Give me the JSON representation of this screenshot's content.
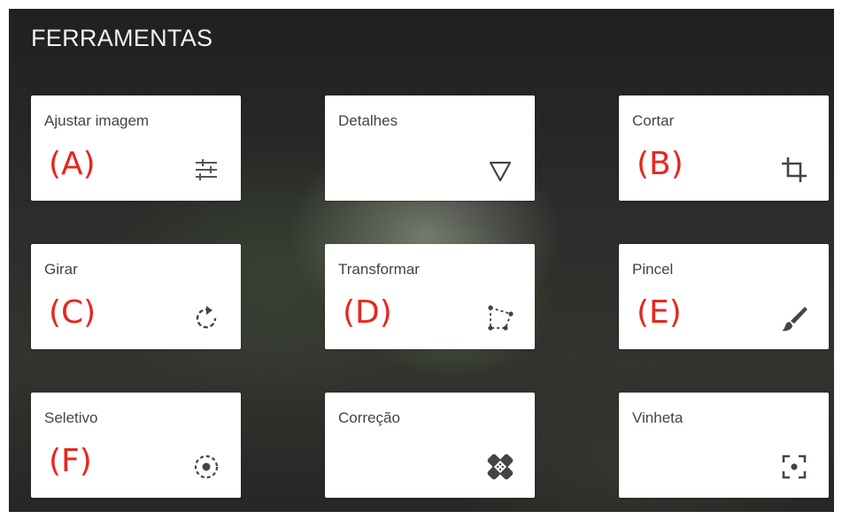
{
  "panel": {
    "title": "FERRAMENTAS"
  },
  "tools": [
    {
      "label": "Ajustar imagem",
      "marker": "(A)",
      "icon": "tune-sliders-icon"
    },
    {
      "label": "Detalhes",
      "marker": "",
      "icon": "triangle-down-icon"
    },
    {
      "label": "Cortar",
      "marker": "(B)",
      "icon": "crop-icon"
    },
    {
      "label": "Girar",
      "marker": "(C)",
      "icon": "rotate-icon"
    },
    {
      "label": "Transformar",
      "marker": "(D)",
      "icon": "perspective-transform-icon"
    },
    {
      "label": "Pincel",
      "marker": "(E)",
      "icon": "brush-icon"
    },
    {
      "label": "Seletivo",
      "marker": "(F)",
      "icon": "selective-target-icon"
    },
    {
      "label": "Correção",
      "marker": "",
      "icon": "healing-bandage-icon"
    },
    {
      "label": "Vinheta",
      "marker": "",
      "icon": "vignette-focus-icon"
    }
  ],
  "colors": {
    "marker": "#e8261f",
    "label": "#444444",
    "card_background": "#ffffff",
    "title": "#f2f2f2"
  }
}
